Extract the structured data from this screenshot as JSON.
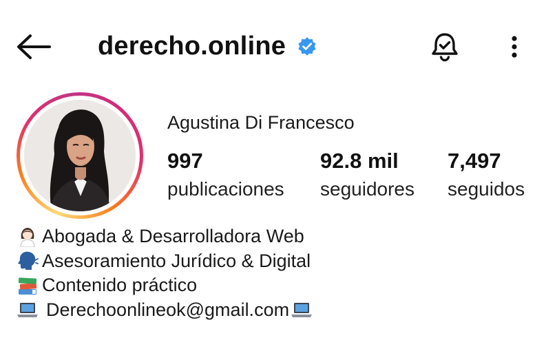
{
  "header": {
    "username": "derecho.online",
    "verified_color": "#3897f0",
    "back_icon": "arrow-left-icon",
    "bell_icon": "bell-check-icon",
    "more_icon": "more-vertical-icon"
  },
  "profile": {
    "full_name": "Agustina Di Francesco",
    "story_ring_colors": [
      "#feda75",
      "#fa7e1e",
      "#d62976",
      "#c13584"
    ]
  },
  "stats": [
    {
      "value": "997",
      "label": "publicaciones"
    },
    {
      "value": "92.8 mil",
      "label": "seguidores"
    },
    {
      "value": "7,497",
      "label": "seguidos"
    }
  ],
  "bio": {
    "lines": [
      {
        "icon": "woman-technologist-emoji",
        "text": "Abogada & Desarrolladora Web"
      },
      {
        "icon": "speaking-head-emoji",
        "text": "Asesoramiento Jurídico & Digital"
      },
      {
        "icon": "books-emoji",
        "text": "Contenido práctico"
      },
      {
        "icon": "laptop-emoji",
        "text": "Derechoonlineok@gmail.com",
        "trailing_icon": "laptop-emoji"
      }
    ]
  }
}
